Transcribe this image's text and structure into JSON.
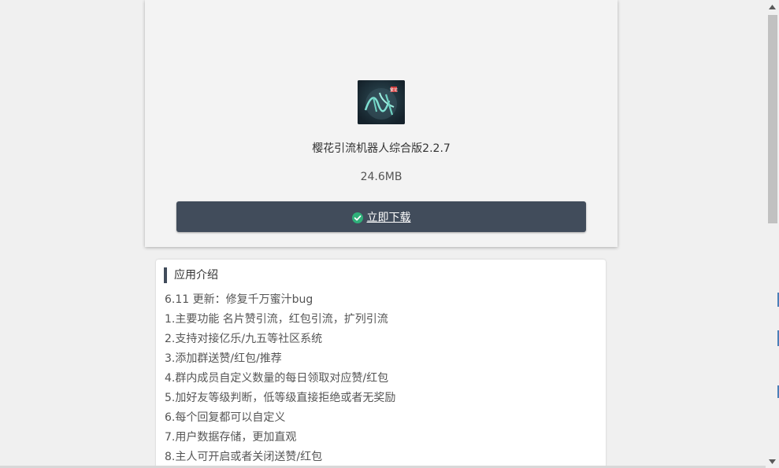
{
  "app": {
    "name": "樱花引流机器人综合版2.2.7",
    "size": "24.6MB",
    "icon": "app-logo-icon",
    "icon_text": "繁花"
  },
  "download": {
    "label": "立即下载",
    "icon": "check-circle-icon",
    "button_color": "#414c5b",
    "check_color": "#2fb07a"
  },
  "intro": {
    "title": "应用介绍",
    "items": [
      "6.11 更新：修复千万蜜汁bug",
      "1.主要功能 名片赞引流，红包引流，扩列引流",
      "2.支持对接亿乐/九五等社区系统",
      "3.添加群送赞/红包/推荐",
      "4.群内成员自定义数量的每日领取对应赞/红包",
      "5.加好友等级判断，低等级直接拒绝或者无奖励",
      "6.每个回复都可以自定义",
      "7.用户数据存储，更加直观",
      "8.主人可开启或者关闭送赞/红包"
    ]
  },
  "scrollbar": {
    "up_icon": "scroll-up-arrow-icon",
    "down_icon": "scroll-down-arrow-icon"
  }
}
